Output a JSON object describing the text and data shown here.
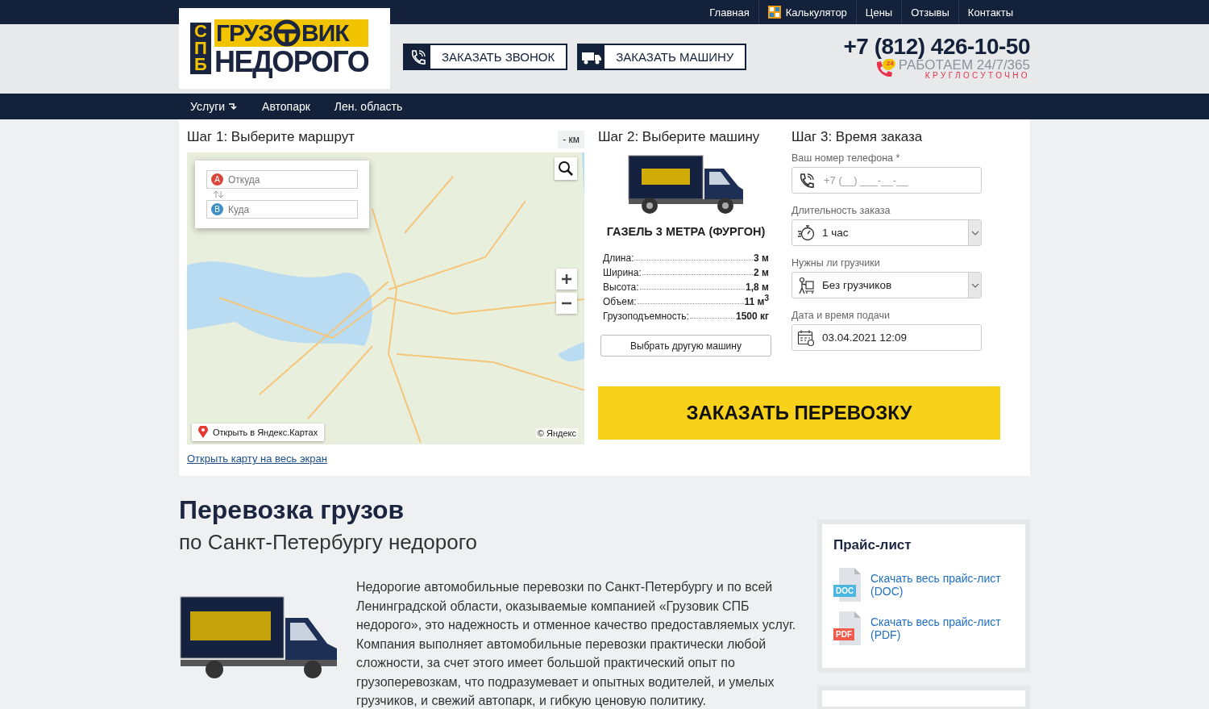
{
  "top_menu": [
    {
      "kind": "text",
      "label": "Главная"
    },
    {
      "kind": "calculator",
      "label": "Калькулятор"
    },
    {
      "kind": "text",
      "label": "Цены"
    },
    {
      "kind": "text",
      "label": "Отзывы"
    },
    {
      "kind": "text",
      "label": "Контакты"
    }
  ],
  "logo": {
    "side": "СПБ",
    "word_1": "ГРУЗ",
    "word_2": "ВИК",
    "bottom": "НЕДОРОГО"
  },
  "header_buttons": [
    {
      "kind": "phone",
      "label": "ЗАКАЗАТЬ ЗВОНОК"
    },
    {
      "kind": "truck",
      "label": "ЗАКАЗАТЬ МАШИНУ"
    }
  ],
  "contact": {
    "phone": "+7 (812) 426-10-50",
    "badge": "24",
    "hours": "РАБОТАЕМ 24/7/365",
    "note": "КРУГЛОСУТОЧНО"
  },
  "nav": [
    {
      "label": "Услуги",
      "has_submenu": true
    },
    {
      "label": "Автопарк",
      "has_submenu": false
    },
    {
      "label": "Лен. область",
      "has_submenu": false
    }
  ],
  "step_1": {
    "title": "Шаг 1: Выберите маршрут",
    "distance": "- км",
    "route": [
      {
        "marker": "A",
        "placeholder": "Откуда",
        "color": "#d9473a"
      },
      {
        "marker": "B",
        "placeholder": "Куда",
        "color": "#3d8fc6"
      }
    ],
    "open_in_maps": "Открыть в Яндекс.Картах",
    "copyright": "© Яндекс",
    "fullscreen_link": "Открыть карту на весь экран"
  },
  "step_2": {
    "title": "Шаг 2: Выберите машину",
    "vehicle": "ГАЗЕЛЬ 3 МЕТРА (ФУРГОН)",
    "specs": [
      {
        "label": "Длина:",
        "value": "3 м"
      },
      {
        "label": "Ширина:",
        "value": "2 м"
      },
      {
        "label": "Высота:",
        "value": "1,8 м"
      },
      {
        "label": "Объем:",
        "value": "11 м$^{3}$"
      },
      {
        "label": "Грузоподъемность:",
        "value": "1500 кг"
      }
    ],
    "button": "Выбрать другую машину"
  },
  "step_3": {
    "title": "Шаг 3: Время заказа",
    "fields": [
      {
        "kind": "phone",
        "label": "Ваш номер телефона *",
        "placeholder": "+7 (__) ___-__-__"
      },
      {
        "kind": "duration",
        "label": "Длительность заказа",
        "value": "1 час"
      },
      {
        "kind": "loaders",
        "label": "Нужны ли грузчики",
        "value": "Без грузчиков"
      },
      {
        "kind": "date",
        "label": "Дата и время подачи",
        "value": "03.04.2021 12:09"
      }
    ]
  },
  "order_button": "ЗАКАЗАТЬ ПЕРЕВОЗКУ",
  "article": {
    "title": "Перевозка грузов",
    "subtitle": "по Санкт-Петербургу недорого",
    "text": "Недорогие автомобильные перевозки по Санкт-Петербургу и по всей Ленинградской области, оказываемые компанией «Грузовик СПБ недорого», это надежность и отменное качество предоставляемых услуг. Компания выполняет автомобильные перевозки практически любой сложности, за счет этого имеет большой практический опыт по грузоперевозкам, что подразумевает и опытных водителей, и умелых грузчиков, и свежий автопарк, и гибкую ценовую политику."
  },
  "price_list": {
    "title": "Прайс-лист",
    "files": [
      {
        "type": "DOC",
        "color": "#4cb6e0",
        "link": "Скачать весь прайс-лист (DOC)"
      },
      {
        "type": "PDF",
        "color": "#ef5b4c",
        "link": "Скачать весь прайс-лист (PDF)"
      }
    ]
  }
}
